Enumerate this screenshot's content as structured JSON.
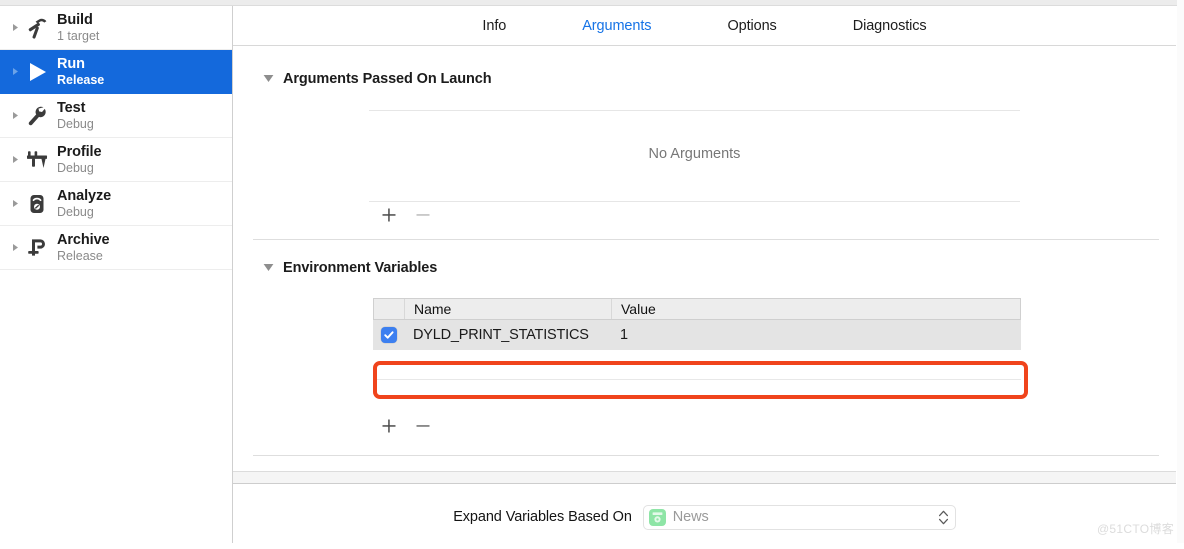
{
  "sidebar": {
    "items": [
      {
        "title": "Build",
        "subtitle": "1 target",
        "icon": "hammer-icon",
        "selected": false
      },
      {
        "title": "Run",
        "subtitle": "Release",
        "icon": "play-icon",
        "selected": true
      },
      {
        "title": "Test",
        "subtitle": "Debug",
        "icon": "wrench-icon",
        "selected": false
      },
      {
        "title": "Profile",
        "subtitle": "Debug",
        "icon": "caliper-icon",
        "selected": false
      },
      {
        "title": "Analyze",
        "subtitle": "Debug",
        "icon": "stethoscope-icon",
        "selected": false
      },
      {
        "title": "Archive",
        "subtitle": "Release",
        "icon": "clamp-icon",
        "selected": false
      }
    ]
  },
  "tabs": [
    {
      "label": "Info",
      "active": false
    },
    {
      "label": "Arguments",
      "active": true
    },
    {
      "label": "Options",
      "active": false
    },
    {
      "label": "Diagnostics",
      "active": false
    }
  ],
  "arguments_section": {
    "title": "Arguments Passed On Launch",
    "empty_text": "No Arguments",
    "add_label": "+",
    "remove_label": "−"
  },
  "env_section": {
    "title": "Environment Variables",
    "columns": [
      "Name",
      "Value"
    ],
    "rows": [
      {
        "checked": true,
        "name": "DYLD_PRINT_STATISTICS",
        "value": "1",
        "highlighted": true
      }
    ],
    "add_label": "+",
    "remove_label": "−"
  },
  "footer": {
    "label": "Expand Variables Based On",
    "popup_value": "News",
    "popup_icon": "news-app-icon"
  },
  "watermark": "@51CTO博客",
  "colors": {
    "accent_blue": "#1469dc",
    "tab_active": "#1673e6",
    "annotation": "#f0441c",
    "checkbox_blue": "#3c7ff0",
    "row_fill": "#e4e4e4",
    "app_icon_green": "#8ee5a6"
  }
}
